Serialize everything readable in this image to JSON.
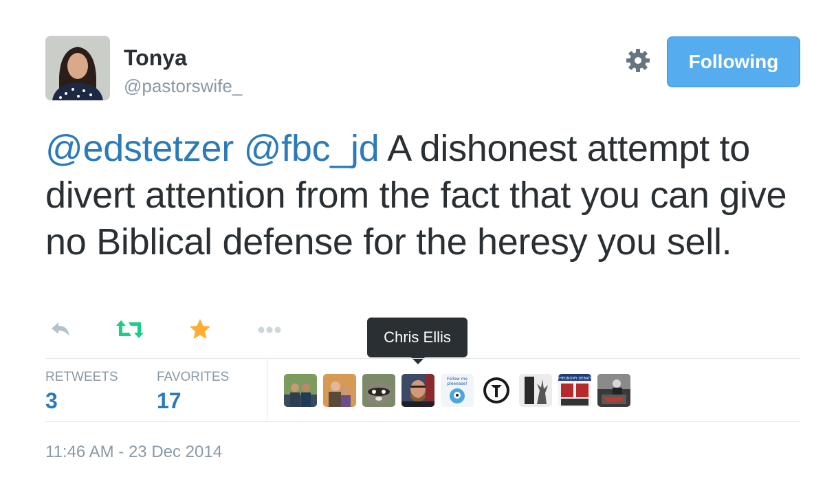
{
  "user": {
    "name": "Tonya",
    "handle": "@pastorswife_"
  },
  "follow_button": {
    "label": "Following"
  },
  "tweet": {
    "mention1": "@edstetzer",
    "mention2": "@fbc_jd",
    "body": " A dishonest attempt to divert attention from the fact that you can give no Biblical defense for the heresy you sell."
  },
  "tooltip": {
    "text": "Chris Ellis"
  },
  "stats": {
    "retweets_label": "RETWEETS",
    "retweets_value": "3",
    "favorites_label": "FAVORITES",
    "favorites_value": "17"
  },
  "favorited_by": [
    {
      "icon": "avatar-two-men"
    },
    {
      "icon": "avatar-couple"
    },
    {
      "icon": "avatar-raccoon"
    },
    {
      "icon": "avatar-man-beard",
      "name": "Chris Ellis"
    },
    {
      "icon": "avatar-follow-me-bird",
      "text": "Follow me pleeease!"
    },
    {
      "icon": "avatar-circle-logo"
    },
    {
      "icon": "avatar-tree-silhouette"
    },
    {
      "icon": "avatar-theonomy-debate",
      "text": "THEONOMY DEBATE"
    },
    {
      "icon": "avatar-preacher"
    }
  ],
  "timestamp": "11:46 AM - 23 Dec 2014",
  "colors": {
    "link": "#2b7bb9",
    "follow_bg": "#55acee",
    "retweet": "#19cf86",
    "favorite": "#ffac33",
    "muted": "#8899a6",
    "text": "#292f33"
  }
}
